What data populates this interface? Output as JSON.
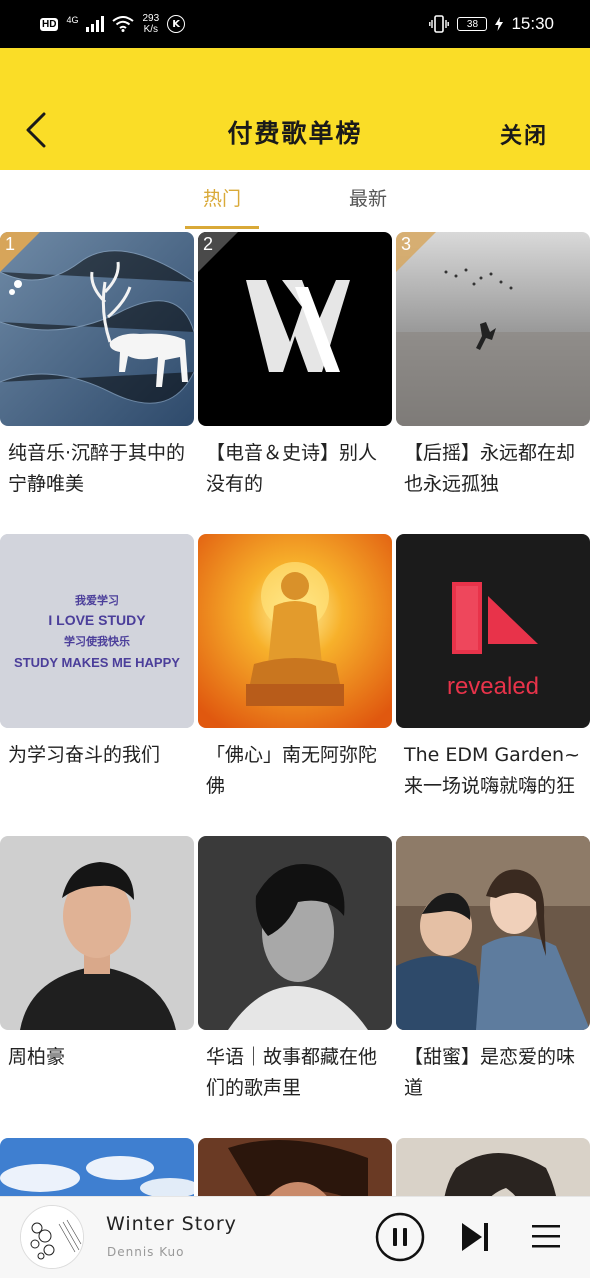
{
  "status_bar": {
    "hd": "HD",
    "network": "4G",
    "speed_value": "293",
    "speed_unit": "K/s",
    "k_badge": "K",
    "battery": "38",
    "time": "15:30"
  },
  "header": {
    "title": "付费歌单榜",
    "close_label": "关闭"
  },
  "tabs": [
    {
      "label": "热门",
      "active": true
    },
    {
      "label": "最新",
      "active": false
    }
  ],
  "playlists": [
    {
      "rank": "1",
      "title": "纯音乐·沉醉于其中的宁静唯美",
      "cover": "deer-illustration"
    },
    {
      "rank": "2",
      "title": "【电音＆史诗】别人没有的",
      "cover": "alan-walker-logo"
    },
    {
      "rank": "3",
      "title": "【后摇】永远都在却也永远孤独",
      "cover": "field-birds-photo"
    },
    {
      "title": "为学习奋斗的我们",
      "cover": "study-text-card",
      "cover_text": [
        "我爱学习",
        "I LOVE STUDY",
        "学习使我快乐",
        "STUDY MAKES ME HAPPY"
      ]
    },
    {
      "title": "「佛心」南无阿弥陀佛",
      "cover": "buddha-image"
    },
    {
      "title": "The EDM Garden~来一场说嗨就嗨的狂",
      "cover": "revealed-logo",
      "cover_text": [
        "revealed"
      ]
    },
    {
      "title": "周柏豪",
      "cover": "man-portrait"
    },
    {
      "title": "华语｜故事都藏在他们的歌声里",
      "cover": "bw-portrait"
    },
    {
      "title": "【甜蜜】是恋爱的味道",
      "cover": "couple-photo"
    },
    {
      "title": "",
      "cover": "sky-clouds"
    },
    {
      "title": "",
      "cover": "man-portrait-2"
    },
    {
      "title": "",
      "cover": "woman-portrait"
    }
  ],
  "player": {
    "song": "Winter Story",
    "artist": "Dennis Kuo"
  },
  "colors": {
    "accent_yellow": "#fadd27",
    "tab_active": "#d9a938",
    "rank_badge": "#d7a55a"
  }
}
